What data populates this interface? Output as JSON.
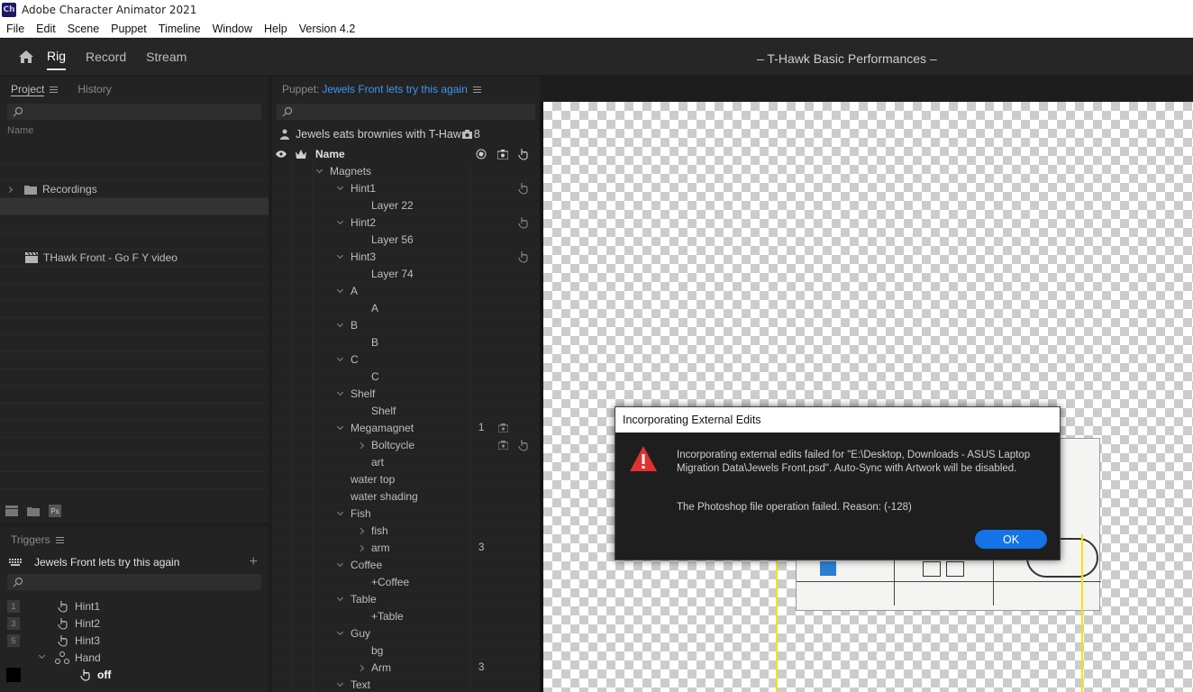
{
  "app": {
    "title": "Adobe Character Animator 2021",
    "icon_text": "Ch"
  },
  "menu": [
    "File",
    "Edit",
    "Scene",
    "Puppet",
    "Timeline",
    "Window",
    "Help",
    "Version 4.2"
  ],
  "workspace": {
    "tabs": [
      "Rig",
      "Record",
      "Stream"
    ],
    "active": "Rig",
    "scene_title": "– T-Hawk Basic Performances –"
  },
  "project_panel": {
    "tabs": [
      "Project",
      "History"
    ],
    "column_header": "Name",
    "items": [
      {
        "label": "Recordings",
        "type": "folder"
      },
      {
        "label": "THawk Front - Go F Y video",
        "type": "scene"
      }
    ]
  },
  "triggers_panel": {
    "title": "Triggers",
    "puppet_name": "Jewels Front lets try this again",
    "items": [
      {
        "key": "1",
        "label": "Hint1"
      },
      {
        "key": "3",
        "label": "Hint2"
      },
      {
        "key": "5",
        "label": "Hint3"
      },
      {
        "key": "",
        "label": "Hand"
      },
      {
        "key": "",
        "label": "off"
      }
    ]
  },
  "puppet_panel": {
    "prefix": "Puppet:",
    "name": "Jewels Front lets try this again",
    "scene_label": "Jewels eats brownies with T-Haw",
    "scene_count": "8",
    "column_header": "Name",
    "rows": [
      {
        "label": "Magnets",
        "indent": 0,
        "chev": "down"
      },
      {
        "label": "Hint1",
        "indent": 1,
        "chev": "down",
        "hand": true
      },
      {
        "label": "Layer 22",
        "indent": 2
      },
      {
        "label": "Hint2",
        "indent": 1,
        "chev": "down",
        "hand": true
      },
      {
        "label": "Layer 56",
        "indent": 2
      },
      {
        "label": "Hint3",
        "indent": 1,
        "chev": "down",
        "hand": true
      },
      {
        "label": "Layer 74",
        "indent": 2
      },
      {
        "label": "A",
        "indent": 1,
        "chev": "down"
      },
      {
        "label": "A",
        "indent": 2
      },
      {
        "label": "B",
        "indent": 1,
        "chev": "down"
      },
      {
        "label": "B",
        "indent": 2
      },
      {
        "label": "C",
        "indent": 1,
        "chev": "down"
      },
      {
        "label": "C",
        "indent": 2
      },
      {
        "label": "Shelf",
        "indent": 1,
        "chev": "down"
      },
      {
        "label": "Shelf",
        "indent": 2
      },
      {
        "label": "Megamagnet",
        "indent": 1,
        "chev": "down",
        "count": "1",
        "cam": true
      },
      {
        "label": "Boltcycle",
        "indent": 2,
        "chev": "right",
        "cam": true,
        "hand": true
      },
      {
        "label": "art",
        "indent": 2
      },
      {
        "label": "water top",
        "indent": 1
      },
      {
        "label": "water shading",
        "indent": 1
      },
      {
        "label": "Fish",
        "indent": 1,
        "chev": "down"
      },
      {
        "label": "fish",
        "indent": 2,
        "chev": "right"
      },
      {
        "label": "arm",
        "indent": 2,
        "chev": "right",
        "count": "3"
      },
      {
        "label": "Coffee",
        "indent": 1,
        "chev": "down"
      },
      {
        "label": "+Coffee",
        "indent": 2
      },
      {
        "label": "Table",
        "indent": 1,
        "chev": "down"
      },
      {
        "label": "+Table",
        "indent": 2
      },
      {
        "label": "Guy",
        "indent": 1,
        "chev": "down"
      },
      {
        "label": "bg",
        "indent": 2
      },
      {
        "label": "Arm",
        "indent": 2,
        "chev": "right",
        "count": "3"
      },
      {
        "label": "Text",
        "indent": 1,
        "chev": "down"
      }
    ]
  },
  "dialog": {
    "title": "Incorporating External Edits",
    "message1": "Incorporating external edits failed for \"E:\\Desktop, Downloads - ASUS Laptop Migration Data\\Jewels Front.psd\". Auto-Sync with Artwork will be disabled.",
    "message2": "The Photoshop file operation failed. Reason:  (-128)",
    "ok_label": "OK"
  },
  "colors": {
    "accent": "#1473e6",
    "link": "#3d97f0",
    "warning": "#e03131",
    "guide": "#f2e600"
  }
}
